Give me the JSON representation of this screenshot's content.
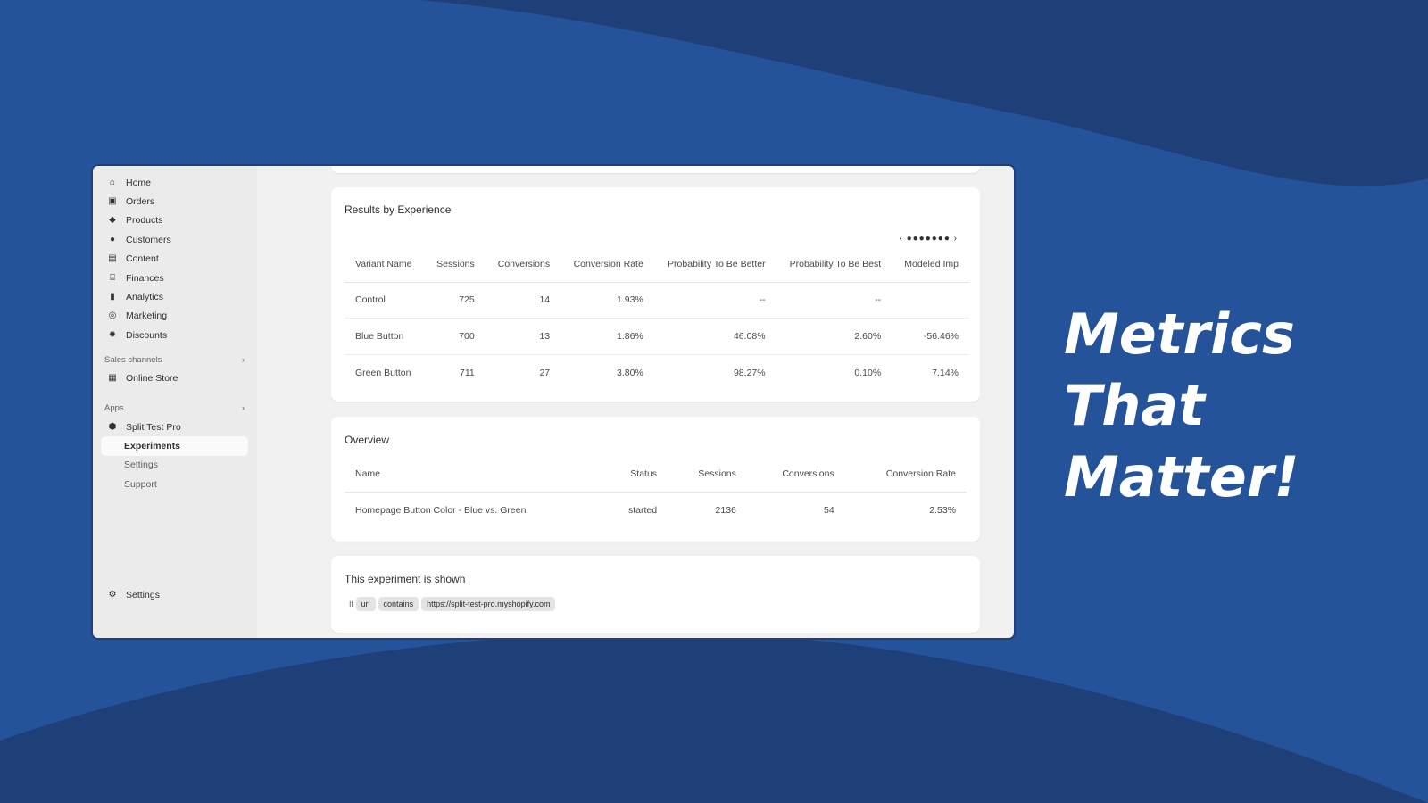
{
  "sidebar": {
    "items": [
      {
        "label": "Home",
        "icon": "home-icon",
        "glyph": "⌂"
      },
      {
        "label": "Orders",
        "icon": "inbox-icon",
        "glyph": "▣"
      },
      {
        "label": "Products",
        "icon": "tag-icon",
        "glyph": "◆"
      },
      {
        "label": "Customers",
        "icon": "person-icon",
        "glyph": "●"
      },
      {
        "label": "Content",
        "icon": "image-icon",
        "glyph": "▤"
      },
      {
        "label": "Finances",
        "icon": "bank-icon",
        "glyph": "⌸"
      },
      {
        "label": "Analytics",
        "icon": "bar-chart-icon",
        "glyph": "▮"
      },
      {
        "label": "Marketing",
        "icon": "target-icon",
        "glyph": "◎"
      },
      {
        "label": "Discounts",
        "icon": "discount-icon",
        "glyph": "✹"
      }
    ],
    "sales_channels": "Sales channels",
    "online_store": "Online Store",
    "apps": "Apps",
    "app_name": "Split Test Pro",
    "experiments": "Experiments",
    "app_settings": "Settings",
    "support": "Support",
    "settings": "Settings"
  },
  "results": {
    "title": "Results by Experience",
    "columns": [
      "Variant Name",
      "Sessions",
      "Conversions",
      "Conversion Rate",
      "Probability To Be Better",
      "Probability To Be Best",
      "Modeled Imp"
    ],
    "rows": [
      [
        "Control",
        "725",
        "14",
        "1.93%",
        "--",
        "--",
        ""
      ],
      [
        "Blue Button",
        "700",
        "13",
        "1.86%",
        "46.08%",
        "2.60%",
        "-56.46%"
      ],
      [
        "Green Button",
        "711",
        "27",
        "3.80%",
        "98.27%",
        "0.10%",
        "7.14%"
      ]
    ]
  },
  "overview": {
    "title": "Overview",
    "columns": [
      "Name",
      "Status",
      "Sessions",
      "Conversions",
      "Conversion Rate"
    ],
    "rows": [
      [
        "Homepage Button Color - Blue vs. Green",
        "started",
        "2136",
        "54",
        "2.53%"
      ]
    ]
  },
  "targeting": {
    "title": "This experiment is shown",
    "if": "If",
    "tags": [
      "url",
      "contains",
      "https://split-test-pro.myshopify.com"
    ]
  },
  "hero": {
    "lines": [
      "Metrics",
      "That",
      "Matter!"
    ]
  }
}
